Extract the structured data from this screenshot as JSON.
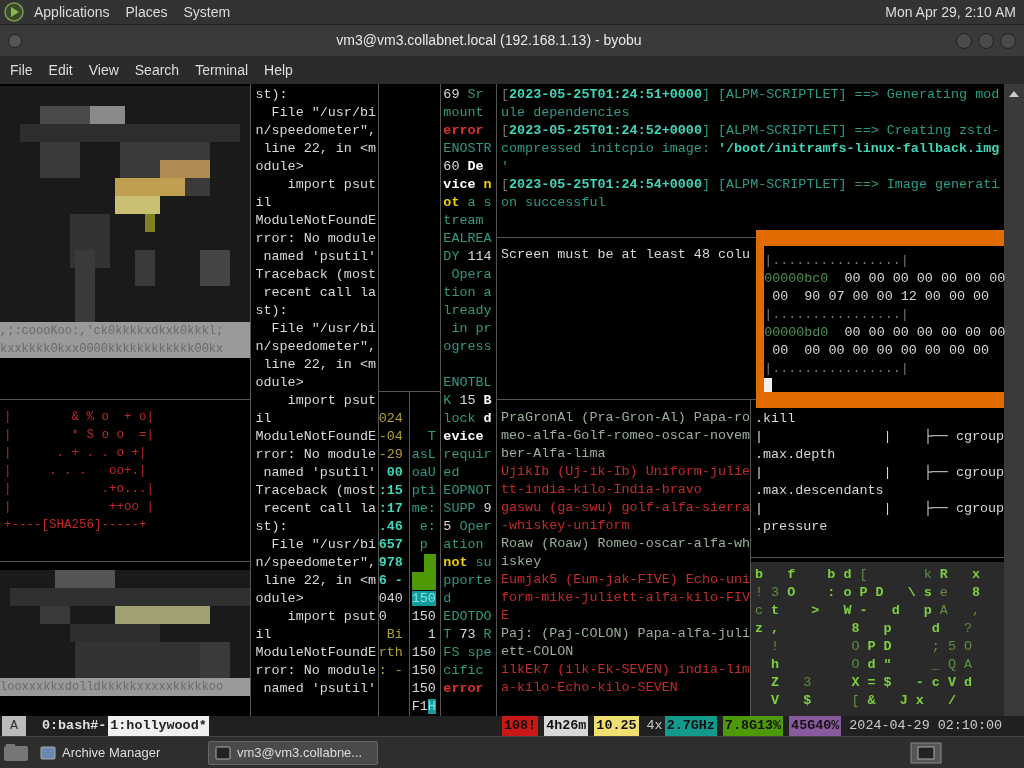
{
  "top_panel": {
    "menus": [
      "Applications",
      "Places",
      "System"
    ],
    "clock": "Mon Apr 29, 2:10 AM"
  },
  "window": {
    "title": "vm3@vm3.collabnet.local (192.168.1.13) - byobu"
  },
  "menu_bar": [
    "File",
    "Edit",
    "View",
    "Search",
    "Terminal",
    "Help"
  ],
  "art_top": {
    "rows": [
      ",;:coooKoo:,'ck0kkkkxdkxk0kkkl;",
      "kxxkkkk0kxx0000kkkkkkkkkkkk00kx"
    ]
  },
  "randomart": [
    "|        & % o  + o|",
    "|        * S o o  =|",
    "|      . + . . o +|",
    "|     . . .   oo+.|",
    "|            .+o...|",
    "|             ++oo |",
    "+----[SHA256]-----+"
  ],
  "art_bottom": {
    "rows": [
      "looxxxkkxdolldkkkkkxxxxxkkkkkoo"
    ]
  },
  "traceback": [
    "st):",
    "  File \"/usr/bi",
    "n/speedometer\",",
    " line 22, in <m",
    "odule>",
    "    import psut",
    "il",
    "ModuleNotFoundE",
    "rror: No module",
    " named 'psutil'",
    "Traceback (most",
    " recent call la",
    "st):",
    "  File \"/usr/bi",
    "n/speedometer\",",
    " line 22, in <m",
    "odule>",
    "    import psut",
    "il",
    "ModuleNotFoundE",
    "rror: No module",
    " named 'psutil'",
    "Traceback (most",
    " recent call la",
    "st):",
    "  File \"/usr/bi",
    "n/speedometer\",",
    " line 22, in <m",
    "odule>",
    "    import psut",
    "il",
    "ModuleNotFoundE",
    "rror: No module",
    " named 'psutil'"
  ],
  "uptime_numbers": [
    [
      {
        "text": "024",
        "kind": "olive"
      }
    ],
    [
      {
        "text": "-04",
        "kind": "olive"
      }
    ],
    [
      {
        "text": "-29",
        "kind": "olive"
      }
    ],
    [
      {
        "text": " 00",
        "kind": "cyan"
      }
    ],
    [
      {
        "text": ":15",
        "kind": "cyan"
      }
    ],
    [
      {
        "text": ":17",
        "kind": "cyan"
      }
    ],
    [
      {
        "text": ".46",
        "kind": "cyan"
      }
    ],
    [
      {
        "text": "657",
        "kind": "cyan"
      }
    ],
    [
      {
        "text": "978",
        "kind": "cyan"
      }
    ],
    [
      {
        "text": "6 -",
        "kind": "cyan"
      }
    ],
    [
      {
        "text": "040",
        "kind": "plain"
      }
    ],
    [
      {
        "text": "0",
        "kind": "plain"
      }
    ],
    [
      {
        "text": " Bi",
        "kind": "olive"
      }
    ],
    [
      {
        "text": "rth",
        "kind": "olive"
      }
    ],
    [
      {
        "text": ": -",
        "kind": "olive"
      }
    ]
  ],
  "uptime_text": [
    [
      [
        {
          "text": "  T",
          "kind": "teal"
        }
      ],
      [
        {
          "text": "asL",
          "kind": "teal"
        }
      ],
      [
        {
          "text": "oaU",
          "kind": "teal"
        }
      ],
      [
        {
          "text": "pti",
          "kind": "teal"
        }
      ],
      [
        {
          "text": "me:",
          "kind": "teal"
        }
      ],
      [
        {
          "text": " e:",
          "kind": "teal"
        }
      ],
      [
        {
          "text": " p",
          "kind": "teal"
        }
      ]
    ],
    [
      [
        {
          "text": "150",
          "kind": "highlight"
        }
      ],
      [
        {
          "text": "150",
          "kind": "plain"
        }
      ],
      [
        {
          "text": "  1",
          "kind": "plain"
        }
      ],
      [
        {
          "text": "150",
          "kind": "plain"
        }
      ],
      [
        {
          "text": "150",
          "kind": "plain"
        }
      ],
      [
        {
          "text": "150",
          "kind": "plain"
        }
      ],
      [
        {
          "text": "F1",
          "kind": "plain"
        },
        {
          "text": "H",
          "kind": "highlight"
        }
      ]
    ]
  ],
  "errno": [
    [
      [
        {
          "text": "69 ",
          "kind": "plain"
        },
        {
          "text": "Sr",
          "kind": "green"
        }
      ],
      [
        {
          "text": "mount",
          "kind": "green"
        }
      ],
      [
        {
          "text": "error",
          "kind": "error"
        }
      ],
      [
        {
          "text": "ENOSTR",
          "kind": "green"
        }
      ],
      [
        {
          "text": "60 ",
          "kind": "plain"
        },
        {
          "text": "De",
          "kind": "bold"
        }
      ],
      [
        {
          "text": "vice ",
          "kind": "bold"
        },
        {
          "text": "n",
          "kind": "warn"
        }
      ],
      [
        {
          "text": "ot",
          "kind": "warn"
        },
        {
          "text": " a s",
          "kind": "green"
        }
      ],
      [
        {
          "text": "tream",
          "kind": "green"
        }
      ],
      [
        {
          "text": "EALREA",
          "kind": "green"
        }
      ],
      [
        {
          "text": "DY ",
          "kind": "green"
        },
        {
          "text": "114",
          "kind": "plain"
        }
      ],
      [
        {
          "text": " Opera",
          "kind": "green"
        }
      ],
      [
        {
          "text": "tion a",
          "kind": "green"
        }
      ],
      [
        {
          "text": "lready",
          "kind": "green"
        }
      ],
      [
        {
          "text": " in pr",
          "kind": "green"
        }
      ],
      [
        {
          "text": "ogress",
          "kind": "green"
        }
      ]
    ],
    [
      [
        {
          "text": "ENOTBL",
          "kind": "green"
        }
      ],
      [
        {
          "text": "K ",
          "kind": "green"
        },
        {
          "text": "15 ",
          "kind": "plain"
        },
        {
          "text": "B",
          "kind": "bold"
        }
      ],
      [
        {
          "text": "lock ",
          "kind": "green"
        },
        {
          "text": "d",
          "kind": "bold"
        }
      ],
      [
        {
          "text": "evice",
          "kind": "bold"
        }
      ],
      [
        {
          "text": "requir",
          "kind": "green"
        }
      ],
      [
        {
          "text": "ed",
          "kind": "green"
        }
      ],
      [
        {
          "text": "EOPNOT",
          "kind": "green"
        }
      ],
      [
        {
          "text": "SUPP ",
          "kind": "green"
        },
        {
          "text": "9",
          "kind": "plain"
        }
      ],
      [
        {
          "text": "5 ",
          "kind": "plain"
        },
        {
          "text": "Oper",
          "kind": "green"
        }
      ],
      [
        {
          "text": "ation",
          "kind": "green"
        }
      ],
      [
        {
          "text": "not",
          "kind": "warn"
        },
        {
          "text": " su",
          "kind": "green"
        }
      ],
      [
        {
          "text": "pporte",
          "kind": "green"
        }
      ],
      [
        {
          "text": "d",
          "kind": "green"
        }
      ],
      [
        {
          "text": "EDOTDO",
          "kind": "green"
        }
      ],
      [
        {
          "text": "T ",
          "kind": "green"
        },
        {
          "text": "73 ",
          "kind": "plain"
        },
        {
          "text": "R",
          "kind": "green"
        }
      ],
      [
        {
          "text": "FS spe",
          "kind": "green"
        }
      ],
      [
        {
          "text": "cific",
          "kind": "green"
        }
      ],
      [
        {
          "text": "error",
          "kind": "error"
        }
      ]
    ]
  ],
  "pacman_log": [
    [
      {
        "text": "[",
        "kind": "gray"
      },
      {
        "text": "2023-05-25T01:24:51+0000",
        "kind": "cyan"
      },
      {
        "text": "] [ALPM-SCRIPTLET] ==> Generating mod",
        "kind": "teal"
      }
    ],
    [
      {
        "text": "ule dependencies",
        "kind": "teal"
      }
    ],
    [
      {
        "text": "[",
        "kind": "gray"
      },
      {
        "text": "2023-05-25T01:24:52+0000",
        "kind": "cyan"
      },
      {
        "text": "] [ALPM-SCRIPTLET] ==> Creating zstd-",
        "kind": "teal"
      }
    ],
    [
      {
        "text": "compressed initcpio image: ",
        "kind": "teal"
      },
      {
        "text": "'/boot/initramfs-linux-fallback.img",
        "kind": "cyan"
      }
    ],
    [
      {
        "text": "'",
        "kind": "teal"
      }
    ],
    [
      {
        "text": "[",
        "kind": "gray"
      },
      {
        "text": "2023-05-25T01:24:54+0000",
        "kind": "cyan"
      },
      {
        "text": "] [ALPM-SCRIPTLET] ==> Image generati",
        "kind": "teal"
      }
    ],
    [
      {
        "text": "on successful",
        "kind": "teal"
      }
    ]
  ],
  "screen_warning": "Screen must be at least 48 colu",
  "hexdump": [
    [
      {
        "text": "|................|",
        "kind": "gray"
      }
    ],
    [
      {
        "text": "00000bc0",
        "kind": "address"
      },
      {
        "text": "  00 00 00 00 00 00 00",
        "kind": "plain"
      }
    ],
    [
      {
        "text": " 00  90 07 00 00 12 00 00 00",
        "kind": "plain"
      }
    ],
    [
      {
        "text": "|................|",
        "kind": "gray"
      }
    ],
    [
      {
        "text": "00000bd0",
        "kind": "address"
      },
      {
        "text": "  00 00 00 00 00 00 00",
        "kind": "plain"
      }
    ],
    [
      {
        "text": " 00  00 00 00 00 00 00 00 00",
        "kind": "plain"
      }
    ],
    [
      {
        "text": "|................|",
        "kind": "gray"
      }
    ]
  ],
  "words": [
    [
      {
        "text": "PraGronAl (Pra-Gron-Al) Papa-ro",
        "kind": "muted"
      }
    ],
    [
      {
        "text": "meo-alfa-Golf-romeo-oscar-novem",
        "kind": "muted"
      }
    ],
    [
      {
        "text": "ber-Alfa-lima",
        "kind": "muted"
      }
    ],
    [
      {
        "text": "UjikIb (Uj-ik-Ib) Uniform-julie",
        "kind": "red"
      }
    ],
    [
      {
        "text": "tt-india-kilo-India-bravo",
        "kind": "red"
      }
    ],
    [
      {
        "text": "gaswu (ga-swu) golf-alfa-sierra",
        "kind": "red"
      }
    ],
    [
      {
        "text": "-whiskey-uniform",
        "kind": "red"
      }
    ],
    [
      {
        "text": "Roaw (Roaw) Romeo-oscar-alfa-wh",
        "kind": "muted"
      }
    ],
    [
      {
        "text": "iskey",
        "kind": "muted"
      }
    ],
    [
      {
        "text": "Eumjak5 (Eum-jak-FIVE) Echo-uni",
        "kind": "red"
      }
    ],
    [
      {
        "text": "form-mike-juliett-alfa-kilo-FIV",
        "kind": "red"
      }
    ],
    [
      {
        "text": "E",
        "kind": "red"
      }
    ],
    [
      {
        "text": "Paj: (Paj-COLON) Papa-alfa-juli",
        "kind": "muted"
      }
    ],
    [
      {
        "text": "ett-COLON",
        "kind": "muted"
      }
    ],
    [
      {
        "text": "ilkEk7 (ilk-Ek-SEVEN) india-lim",
        "kind": "red"
      }
    ],
    [
      {
        "text": "a-kilo-Echo-kilo-SEVEN",
        "kind": "red"
      }
    ]
  ],
  "cgroup_tree": [
    ".kill",
    "|               |    ├── cgroup",
    ".max.depth",
    "|               |    ├── cgroup",
    ".max.descendants",
    "|               |    ├── cgroup",
    ".pressure"
  ],
  "matrix": [
    [
      {
        "text": "b   f    b d ",
        "kind": "matrix"
      },
      {
        "text": "[       k ",
        "kind": "faint"
      },
      {
        "text": "R   x",
        "kind": "matrix"
      }
    ],
    [
      {
        "text": "! 3 ",
        "kind": "faint"
      },
      {
        "text": "O    : o P D   \\ s ",
        "kind": "matrix"
      },
      {
        "text": "e   ",
        "kind": "faint"
      },
      {
        "text": "8",
        "kind": "matrix"
      }
    ],
    [
      {
        "text": "c ",
        "kind": "faint"
      },
      {
        "text": "t    >   W -   d   p ",
        "kind": "matrix"
      },
      {
        "text": "A   ,",
        "kind": "faint"
      }
    ],
    [
      {
        "text": "z ,         8   p     d   ",
        "kind": "matrix"
      },
      {
        "text": "?",
        "kind": "faint"
      }
    ],
    [
      {
        "text": "  !         O ",
        "kind": "faint"
      },
      {
        "text": "P D     ",
        "kind": "matrix"
      },
      {
        "text": "; 5 O",
        "kind": "faint"
      }
    ],
    [
      {
        "text": "  h         ",
        "kind": "matrix"
      },
      {
        "text": "O ",
        "kind": "faint"
      },
      {
        "text": "d \"     ",
        "kind": "matrix"
      },
      {
        "text": "_ Q A",
        "kind": "faint"
      }
    ],
    [
      {
        "text": "  Z   ",
        "kind": "matrix"
      },
      {
        "text": "3     ",
        "kind": "faint"
      },
      {
        "text": "X = $   - c V d",
        "kind": "matrix"
      }
    ],
    [
      {
        "text": "  V   $     ",
        "kind": "matrix"
      },
      {
        "text": "[ ",
        "kind": "faint"
      },
      {
        "text": "&   J x   /",
        "kind": "matrix"
      }
    ]
  ],
  "status_bar": {
    "session": "A",
    "windows": [
      {
        "label": "0:bash#-",
        "selected": false
      },
      {
        "label": "1:hollywood*",
        "selected": true
      }
    ],
    "indicators": [
      {
        "text": "108!",
        "color": "#c81818"
      },
      {
        "text": "4h26m",
        "color": "#d8d8d8"
      },
      {
        "text": "10.25",
        "color": "#f0e070"
      },
      {
        "text": "4x"
      },
      {
        "text": "2.7GHz",
        "color": "#139a8c"
      },
      {
        "text": "7.8G13%",
        "color": "#4e9a06"
      },
      {
        "text": "45G40%",
        "color": "#8a5a9e"
      },
      {
        "text": "2024-04-29 02:10:00"
      }
    ]
  },
  "taskbar": {
    "tasks": [
      {
        "label": "Archive Manager",
        "selected": false
      },
      {
        "label": "vm3@vm3.collabne...",
        "selected": true
      }
    ]
  }
}
